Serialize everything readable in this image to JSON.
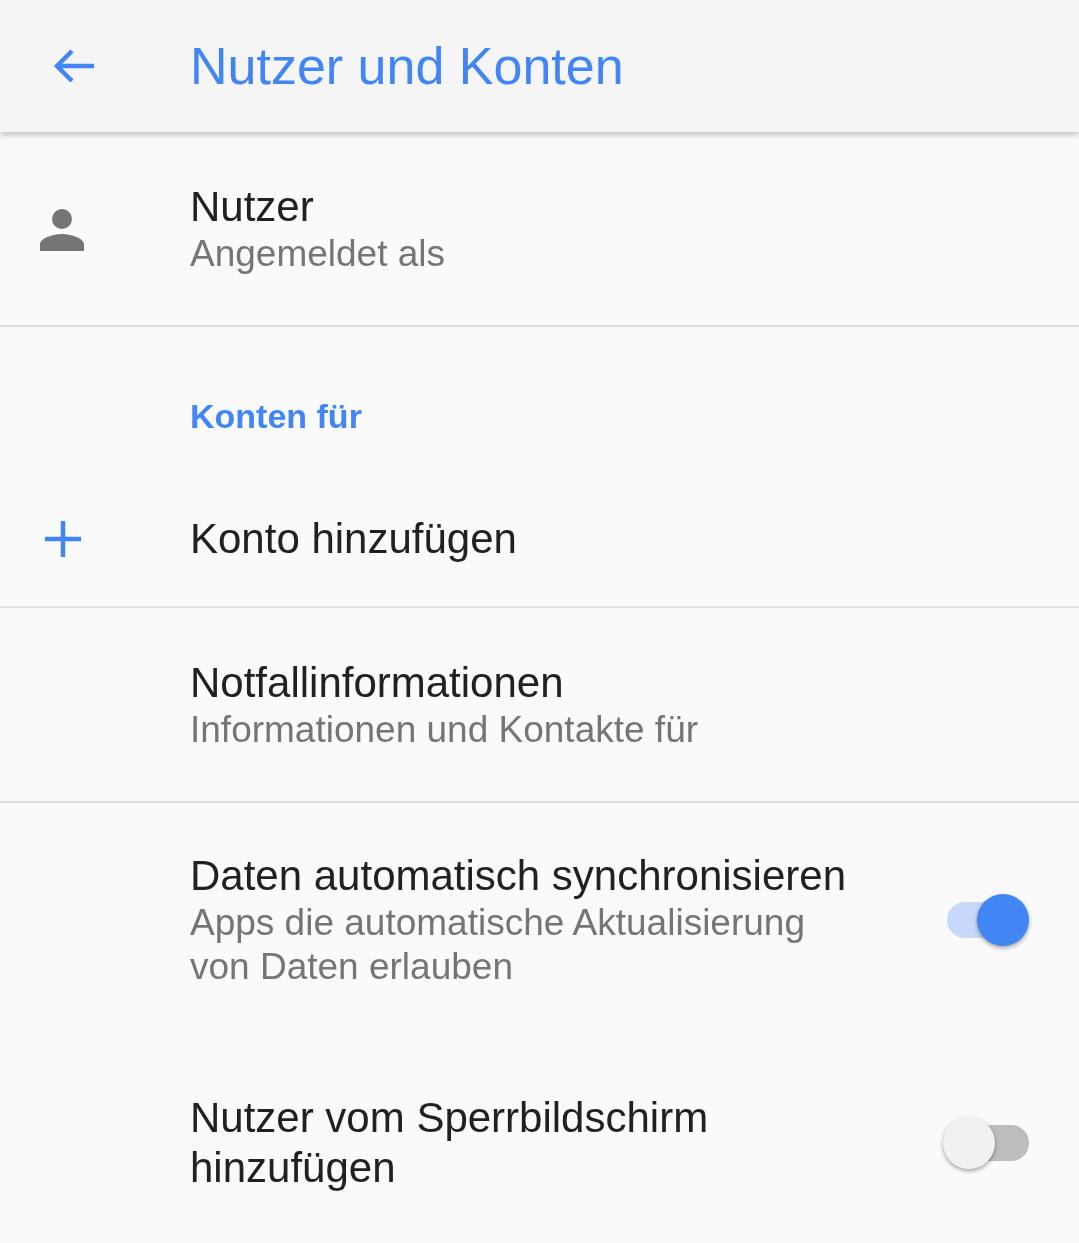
{
  "app_bar": {
    "title": "Nutzer und Konten"
  },
  "items": [
    {
      "kind": "user",
      "title": "Nutzer",
      "subtitle": "Angemeldet als",
      "divider": true
    },
    {
      "kind": "section",
      "title": "Konten für",
      "divider": false
    },
    {
      "kind": "add",
      "title": "Konto hinzufügen",
      "divider": true
    },
    {
      "kind": "info",
      "title": "Notfallinformationen",
      "subtitle": "Informationen und Kontakte für",
      "divider": true
    },
    {
      "kind": "toggle",
      "title": "Daten automatisch synchronisieren",
      "subtitle": "Apps die automatische Aktualisierung von Daten erlauben",
      "on": true,
      "divider": false
    },
    {
      "kind": "toggle",
      "title": "Nutzer vom Sperrbildschirm hinzufügen",
      "on": false,
      "divider": false
    }
  ]
}
